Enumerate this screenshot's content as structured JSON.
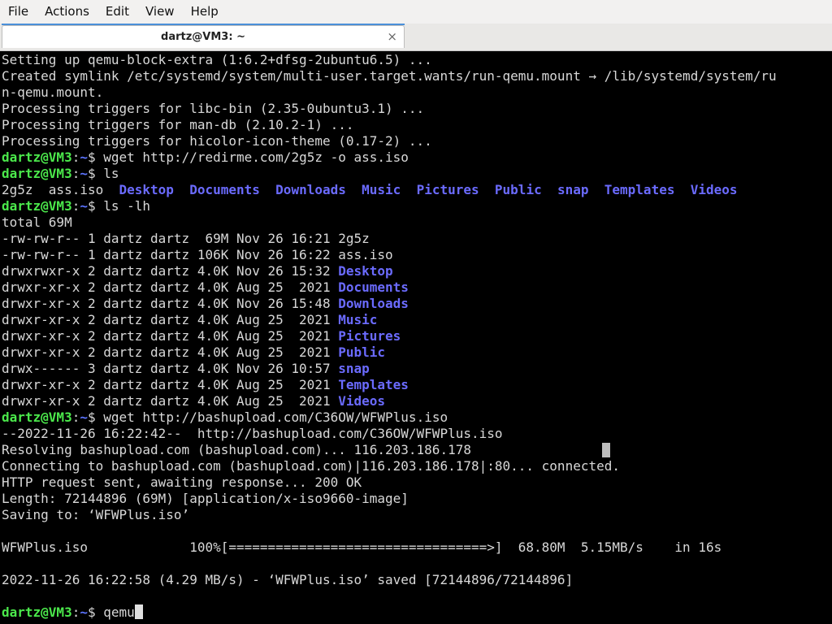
{
  "menu": [
    "File",
    "Actions",
    "Edit",
    "View",
    "Help"
  ],
  "tab": {
    "title": "dartz@VM3: ~",
    "close": "×"
  },
  "prompt": {
    "user": "dartz@VM3",
    "sep": ":",
    "path": "~",
    "symbol": "$ "
  },
  "lines": [
    {
      "text": "Setting up qemu-block-extra (1:6.2+dfsg-2ubuntu6.5) ..."
    },
    {
      "text": "Created symlink /etc/systemd/system/multi-user.target.wants/run-qemu.mount → /lib/systemd/system/ru"
    },
    {
      "text": "n-qemu.mount."
    },
    {
      "text": "Processing triggers for libc-bin (2.35-0ubuntu3.1) ..."
    },
    {
      "text": "Processing triggers for man-db (2.10.2-1) ..."
    },
    {
      "text": "Processing triggers for hicolor-icon-theme (0.17-2) ..."
    },
    {
      "prompt": true,
      "text": "wget http://redirme.com/2g5z -o ass.iso"
    },
    {
      "prompt": true,
      "text": "ls"
    },
    {
      "ls": [
        {
          "t": "2g5z",
          "dir": false
        },
        {
          "t": "ass.iso",
          "dir": false
        },
        {
          "t": "Desktop",
          "dir": true
        },
        {
          "t": "Documents",
          "dir": true
        },
        {
          "t": "Downloads",
          "dir": true
        },
        {
          "t": "Music",
          "dir": true
        },
        {
          "t": "Pictures",
          "dir": true
        },
        {
          "t": "Public",
          "dir": true
        },
        {
          "t": "snap",
          "dir": true
        },
        {
          "t": "Templates",
          "dir": true
        },
        {
          "t": "Videos",
          "dir": true
        }
      ]
    },
    {
      "prompt": true,
      "text": "ls -lh"
    },
    {
      "text": "total 69M"
    },
    {
      "text": "-rw-rw-r-- 1 dartz dartz  69M Nov 26 16:21 ",
      "name": "2g5z",
      "isdir": false
    },
    {
      "text": "-rw-rw-r-- 1 dartz dartz 106K Nov 26 16:22 ",
      "name": "ass.iso",
      "isdir": false
    },
    {
      "text": "drwxrwxr-x 2 dartz dartz 4.0K Nov 26 15:32 ",
      "name": "Desktop",
      "isdir": true
    },
    {
      "text": "drwxr-xr-x 2 dartz dartz 4.0K Aug 25  2021 ",
      "name": "Documents",
      "isdir": true
    },
    {
      "text": "drwxr-xr-x 2 dartz dartz 4.0K Nov 26 15:48 ",
      "name": "Downloads",
      "isdir": true
    },
    {
      "text": "drwxr-xr-x 2 dartz dartz 4.0K Aug 25  2021 ",
      "name": "Music",
      "isdir": true
    },
    {
      "text": "drwxr-xr-x 2 dartz dartz 4.0K Aug 25  2021 ",
      "name": "Pictures",
      "isdir": true
    },
    {
      "text": "drwxr-xr-x 2 dartz dartz 4.0K Aug 25  2021 ",
      "name": "Public",
      "isdir": true
    },
    {
      "text": "drwx------ 3 dartz dartz 4.0K Nov 26 10:57 ",
      "name": "snap",
      "isdir": true
    },
    {
      "text": "drwxr-xr-x 2 dartz dartz 4.0K Aug 25  2021 ",
      "name": "Templates",
      "isdir": true
    },
    {
      "text": "drwxr-xr-x 2 dartz dartz 4.0K Aug 25  2021 ",
      "name": "Videos",
      "isdir": true
    },
    {
      "prompt": true,
      "text": "wget http://bashupload.com/C36OW/WFWPlus.iso"
    },
    {
      "text": "--2022-11-26 16:22:42--  http://bashupload.com/C36OW/WFWPlus.iso"
    },
    {
      "text": "Resolving bashupload.com (bashupload.com)... 116.203.186.178"
    },
    {
      "text": "Connecting to bashupload.com (bashupload.com)|116.203.186.178|:80... connected."
    },
    {
      "text": "HTTP request sent, awaiting response... 200 OK"
    },
    {
      "text": "Length: 72144896 (69M) [application/x-iso9660-image]"
    },
    {
      "text": "Saving to: ‘WFWPlus.iso’"
    },
    {
      "text": ""
    },
    {
      "text": "WFWPlus.iso             100%[=================================>]  68.80M  5.15MB/s    in 16s"
    },
    {
      "text": ""
    },
    {
      "text": "2022-11-26 16:22:58 (4.29 MB/s) - ‘WFWPlus.iso’ saved [72144896/72144896]"
    },
    {
      "text": ""
    },
    {
      "prompt": true,
      "text": "qemu",
      "cursor": true
    }
  ],
  "colors": {
    "prompt_user": "#4be84b",
    "prompt_path": "#5c74ff",
    "directory": "#6b6bff",
    "text": "#d8d8d8",
    "background": "#000000"
  }
}
